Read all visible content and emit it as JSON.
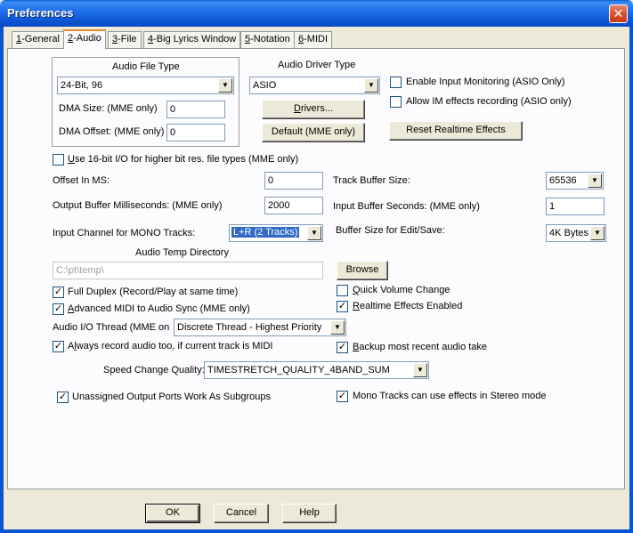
{
  "window": {
    "title": "Preferences",
    "close": "✕"
  },
  "tabs": [
    {
      "key": "1",
      "rest": "-General"
    },
    {
      "key": "2",
      "rest": "-Audio"
    },
    {
      "key": "3",
      "rest": "-File"
    },
    {
      "key": "4",
      "rest": "-Big Lyrics Window"
    },
    {
      "key": "5",
      "rest": "-Notation"
    },
    {
      "key": "6",
      "rest": "-MIDI"
    }
  ],
  "audio_file_type": {
    "title": "Audio File Type",
    "value": "24-Bit, 96",
    "dma_size_label": "DMA Size: (MME only)",
    "dma_size_value": "0",
    "dma_offset_label": "DMA Offset: (MME only)",
    "dma_offset_value": "0"
  },
  "audio_driver": {
    "title": "Audio Driver Type",
    "value": "ASIO",
    "drivers_pre": "",
    "drivers_key": "D",
    "drivers_post": "rivers...",
    "default_button": "Default (MME only)"
  },
  "monitoring": {
    "enable_input_monitoring": "Enable Input Monitoring (ASIO Only)",
    "allow_im_effects": "Allow IM effects recording (ASIO only)",
    "reset_realtime": "Reset Realtime Effects"
  },
  "use16bit": {
    "key": "U",
    "rest": "se 16-bit I/O for higher bit res. file types (MME only)"
  },
  "offset": {
    "label": "Offset In MS:",
    "value": "0"
  },
  "output_buffer": {
    "label": "Output Buffer Milliseconds: (MME only)",
    "value": "2000"
  },
  "input_channel": {
    "label": "Input Channel for MONO Tracks:",
    "value": "L+R (2 Tracks)"
  },
  "track_buffer": {
    "label": "Track Buffer Size:",
    "value": "65536"
  },
  "input_buffer": {
    "label": "Input Buffer Seconds: (MME only)",
    "value": "1"
  },
  "buffer_edit": {
    "label": "Buffer Size for Edit/Save:",
    "value": "4K Bytes"
  },
  "temp_dir": {
    "label": "Audio Temp Directory",
    "value": "C:\\pt\\temp\\",
    "browse": "Browse"
  },
  "options": {
    "full_duplex": "Full Duplex (Record/Play at same time)",
    "advanced_midi_key": "A",
    "advanced_midi_rest": "dvanced MIDI to Audio Sync (MME only)",
    "quick_volume_key": "Q",
    "quick_volume_rest": "uick Volume Change",
    "realtime_key": "R",
    "realtime_rest": "ealtime Effects Enabled",
    "io_thread_label": "Audio I/O Thread (MME on",
    "io_thread_value": "Discrete Thread - Highest Priority",
    "always_record_pre": "A",
    "always_record_key": "l",
    "always_record_rest": "ways record audio too, if current track is MIDI",
    "backup_key": "B",
    "backup_rest": "ackup most recent audio take",
    "speed_label": "Speed Change Quality:",
    "speed_value": "TIMESTRETCH_QUALITY_4BAND_SUM",
    "unassigned_ports": "Unassigned Output Ports Work As Subgroups",
    "mono_tracks": "Mono Tracks can use effects in Stereo mode"
  },
  "checks": {
    "enable_input_monitoring": false,
    "allow_im_effects": false,
    "use16bit": false,
    "full_duplex": true,
    "advanced_midi": true,
    "quick_volume": false,
    "realtime": true,
    "always_record": true,
    "backup": true,
    "unassigned_ports": true,
    "mono_tracks": true
  },
  "footer": {
    "ok": "OK",
    "cancel": "Cancel",
    "help": "Help"
  },
  "glyphs": {
    "check": "✓",
    "arrow": "▼"
  }
}
